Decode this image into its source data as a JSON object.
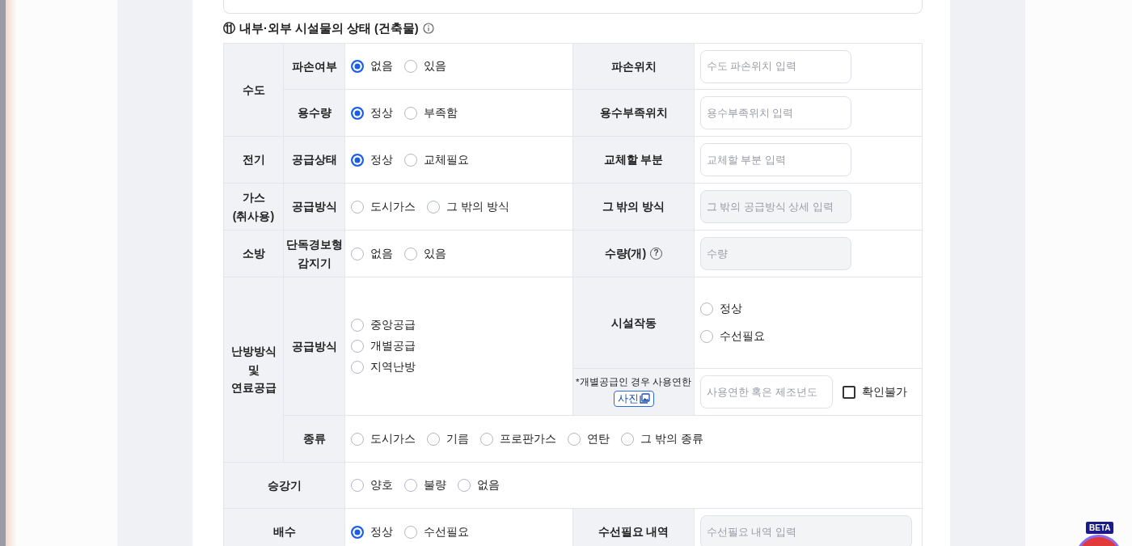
{
  "heading": {
    "number": "⑪",
    "title": "내부·외부 시설물의 상태 (건축물)"
  },
  "sections": [
    {
      "label": "수도",
      "rows": [
        {
          "label": "파손여부",
          "kind": "inline",
          "options": [
            {
              "label": "없음",
              "selected": true
            },
            {
              "label": "있음",
              "selected": false
            }
          ],
          "side": [
            {
              "kind": "field",
              "label": "파손위치",
              "placeholder": "수도 파손위치 입력",
              "disabled": false
            }
          ]
        },
        {
          "label": "용수량",
          "kind": "inline",
          "options": [
            {
              "label": "정상",
              "selected": true
            },
            {
              "label": "부족함",
              "selected": false
            }
          ],
          "side": [
            {
              "kind": "field",
              "label": "용수부족위치",
              "placeholder": "용수부족위치 입력",
              "disabled": false
            }
          ]
        }
      ]
    },
    {
      "label": "전기",
      "rows": [
        {
          "label": "공급상태",
          "kind": "inline",
          "options": [
            {
              "label": "정상",
              "selected": true
            },
            {
              "label": "교체필요",
              "selected": false
            }
          ],
          "side": [
            {
              "kind": "field",
              "label": "교체할 부분",
              "placeholder": "교체할 부분 입력",
              "disabled": false
            }
          ]
        }
      ]
    },
    {
      "label": "가스 (취사용)",
      "rows": [
        {
          "label": "공급방식",
          "kind": "inline",
          "options": [
            {
              "label": "도시가스",
              "selected": false
            },
            {
              "label": "그 밖의 방식",
              "selected": false
            }
          ],
          "side": [
            {
              "kind": "field",
              "label": "그 밖의 방식",
              "placeholder": "그 밖의 공급방식 상세 입력",
              "disabled": true
            }
          ]
        }
      ]
    },
    {
      "label": "소방",
      "rows": [
        {
          "label": "단독경보형 감지기",
          "kind": "inline",
          "options": [
            {
              "label": "없음",
              "selected": false
            },
            {
              "label": "있음",
              "selected": false
            }
          ],
          "side": [
            {
              "kind": "field",
              "label": "수량(개)",
              "help": "?",
              "placeholder": "수량",
              "disabled": true
            }
          ]
        }
      ]
    },
    {
      "label": "난방방식 및 연료공급",
      "rows": [
        {
          "label": "공급방식",
          "kind": "vertical",
          "options": [
            {
              "label": "중앙공급",
              "selected": false
            },
            {
              "label": "개별공급",
              "selected": false
            },
            {
              "label": "지역난방",
              "selected": false
            }
          ],
          "side": [
            {
              "kind": "radio",
              "label": "시설작동",
              "options": [
                {
                  "label": "정상",
                  "selected": false
                },
                {
                  "label": "수선필요",
                  "selected": false
                }
              ]
            },
            {
              "kind": "note",
              "note": "*개별공급인 경우 사용연한",
              "button": "사진",
              "placeholder": "사용연한 혹은 제조년도",
              "disabled": false,
              "checkbox": {
                "label": "확인불가",
                "checked": false
              }
            }
          ]
        },
        {
          "label": "종류",
          "kind": "inline",
          "options": [
            {
              "label": "도시가스",
              "selected": false
            },
            {
              "label": "기름",
              "selected": false
            },
            {
              "label": "프로판가스",
              "selected": false
            },
            {
              "label": "연탄",
              "selected": false
            },
            {
              "label": "그 밖의 종류",
              "selected": false
            }
          ]
        }
      ]
    },
    {
      "label": "승강기",
      "rows": [
        {
          "kind": "inline",
          "options": [
            {
              "label": "양호",
              "selected": false
            },
            {
              "label": "불량",
              "selected": false
            },
            {
              "label": "없음",
              "selected": false
            }
          ]
        }
      ]
    },
    {
      "label": "배수",
      "rows": [
        {
          "kind": "inline",
          "options": [
            {
              "label": "정상",
              "selected": true
            },
            {
              "label": "수선필요",
              "selected": false
            }
          ],
          "side": [
            {
              "kind": "field",
              "label": "수선필요 내역",
              "placeholder": "수선필요 내역 입력",
              "disabled": true
            }
          ]
        }
      ]
    }
  ],
  "widget": {
    "badge": "BETA"
  }
}
